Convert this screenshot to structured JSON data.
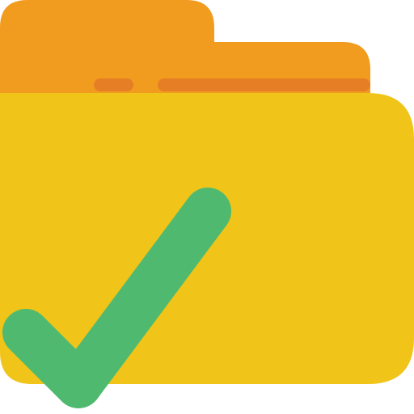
{
  "icon": {
    "name": "folder-check-icon",
    "colors": {
      "folder_back": "#F29C1F",
      "folder_front": "#F0C419",
      "folder_tab_stripe": "#E57E25",
      "checkmark": "#4FBA6F",
      "background": "#FFFFFF"
    }
  }
}
